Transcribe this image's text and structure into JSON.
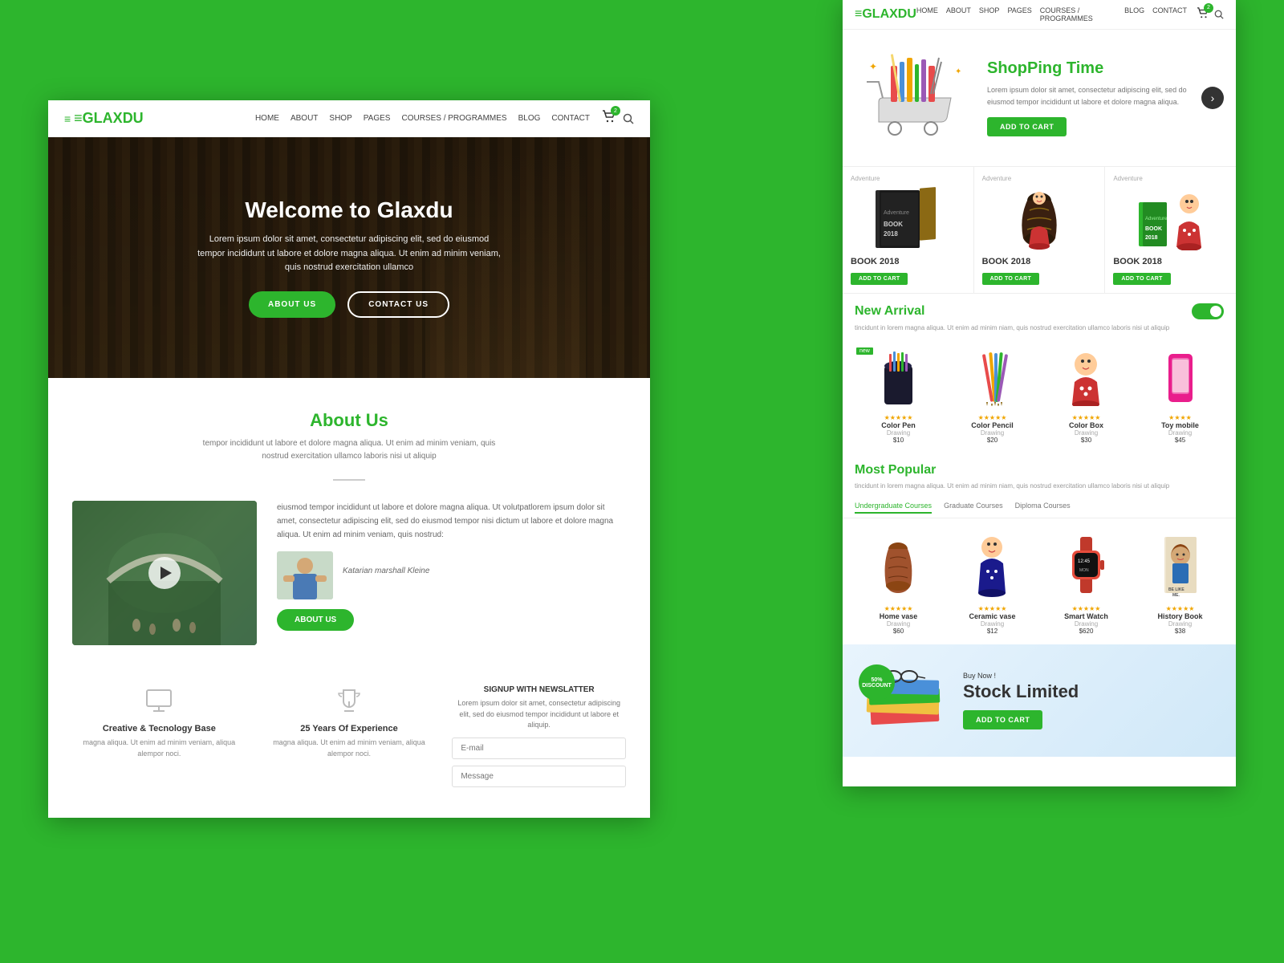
{
  "site": {
    "name_prefix": "EGLAX",
    "name_suffix": "DU"
  },
  "left_nav": {
    "logo_prefix": "≡GLAX",
    "logo_suffix": "DU",
    "links": [
      "HOME",
      "ABOUT",
      "SHOP",
      "PAGES",
      "COURSES / PROGRAMMES",
      "BLOG",
      "CONTACT"
    ],
    "cart_count": "2"
  },
  "hero": {
    "title": "Welcome to Glaxdu",
    "description": "Lorem ipsum dolor sit amet, consectetur adipiscing elit, sed do eiusmod tempor incididunt ut labore et dolore magna aliqua. Ut enim ad minim veniam, quis nostrud exercitation ullamco",
    "btn_about": "ABOUT US",
    "btn_contact": "CONTACT US"
  },
  "about": {
    "title": "About ",
    "title_accent": "Us",
    "subtitle": "tempor incididunt ut labore et dolore magna aliqua. Ut enim ad minim veniam, quis nostrud exercitation ullamco laboris nisi ut aliquip",
    "body_text1": "eiusmod tempor incididunt ut labore et dolore magna aliqua. Ut volutpatlorem ipsum dolor sit amet, consectetur adipiscing elit, sed do eiusmod tempor nisi dictum ut labore et dolore magna aliqua. Ut enim ad minim veniam, quis nostrud:",
    "body_text2": "aliqua. Ut enim ad minim veniam, quis nostrud",
    "person_name": "Katarian marshall Kleine",
    "btn_about": "ABOUT US"
  },
  "features": [
    {
      "icon": "🖥️",
      "title": "Creative & Tecnology Base",
      "text": "magna aliqua. Ut enim ad minim veniam, aliqua alempor noci."
    },
    {
      "icon": "🏆",
      "title": "25 Years Of Experience",
      "text": "magna aliqua. Ut enim ad minim veniam, aliqua alempor noci."
    },
    {
      "icon": "",
      "title": "SIGNUP WITH NEWSLATTER",
      "text": "Lorem ipsum dolor sit amet, consectetur adipiscing elit, sed do eiusmod tempor incididunt ut labore et aliquip."
    }
  ],
  "newsletter": {
    "title": "SIGNUP WITH NEWSLATTER",
    "description": "Lorem ipsum dolor sit amet, consectetur adipiscing elit, sed do eiusmod tempor incididunt ut labore et aliquip.",
    "email_placeholder": "E-mail",
    "message_placeholder": "Message"
  },
  "right_nav": {
    "logo_prefix": "≡GLAX",
    "logo_suffix": "DU",
    "links": [
      "HOME",
      "ABOUT",
      "SHOP",
      "PAGES",
      "COURSES / PROGRAMMES",
      "BLOG",
      "CONTACT"
    ],
    "cart_count": "2"
  },
  "shopping_banner": {
    "title": "ShopPing Time",
    "description": "Lorem ipsum dolor sit amet, consectetur adipiscing elit, sed do eiusmod tempor incididunt ut labore et dolore magna aliqua.",
    "btn_label": "ADD TO CART"
  },
  "product_cards": [
    {
      "badge": "Adventure",
      "name": "BOOK 2018",
      "btn_label": "ADD TO CART"
    },
    {
      "badge": "Adventure",
      "name": "BOOK 2018",
      "btn_label": "ADD TO CART"
    },
    {
      "badge": "Adventure",
      "name": "BOOK 2018",
      "btn_label": "ADD TO CART"
    }
  ],
  "new_arrival": {
    "heading": "New ",
    "heading_accent": "Arrival",
    "description": "tincidunt in lorem magna aliqua. Ut enim ad minim niam, quis nostrud exercitation ullamco laboris nisi ut aliquip",
    "items": [
      {
        "name": "Color Pen",
        "sub": "Drawing",
        "stars": "★★★★★",
        "price": "$10",
        "is_new": true
      },
      {
        "name": "Color Pencil",
        "sub": "Drawing",
        "stars": "★★★★★",
        "price": "$20",
        "is_new": false
      },
      {
        "name": "Color Box",
        "sub": "Drawing",
        "stars": "★★★★★",
        "price": "$30",
        "is_new": false
      },
      {
        "name": "Toy mobile",
        "sub": "Drawing",
        "stars": "★★★★",
        "price": "$45",
        "is_new": false
      }
    ]
  },
  "most_popular": {
    "heading": "Most ",
    "heading_accent": "Popular",
    "description": "tincidunt in lorem magna aliqua. Ut enim ad minim niam, quis nostrud exercitation ullamco laboris nisi ut aliquip",
    "tabs": [
      "Undergraduate Courses",
      "Graduate Courses",
      "Diploma Courses"
    ],
    "items": [
      {
        "name": "Home vase",
        "sub": "Drawing",
        "stars": "★★★★★",
        "price": "$60"
      },
      {
        "name": "Ceramic vase",
        "sub": "Drawing",
        "stars": "★★★★★",
        "price": "$12"
      },
      {
        "name": "Smart Watch",
        "sub": "Drawing",
        "stars": "★★★★★",
        "price": "$620"
      },
      {
        "name": "History Book",
        "sub": "Drawing",
        "stars": "★★★★★",
        "price": "$38"
      }
    ]
  },
  "stock_banner": {
    "discount": "50%",
    "discount_label": "DISCOUNT",
    "sub_title": "Buy Now !",
    "title": "Stock Limited",
    "btn_label": "ADD TO CART"
  }
}
